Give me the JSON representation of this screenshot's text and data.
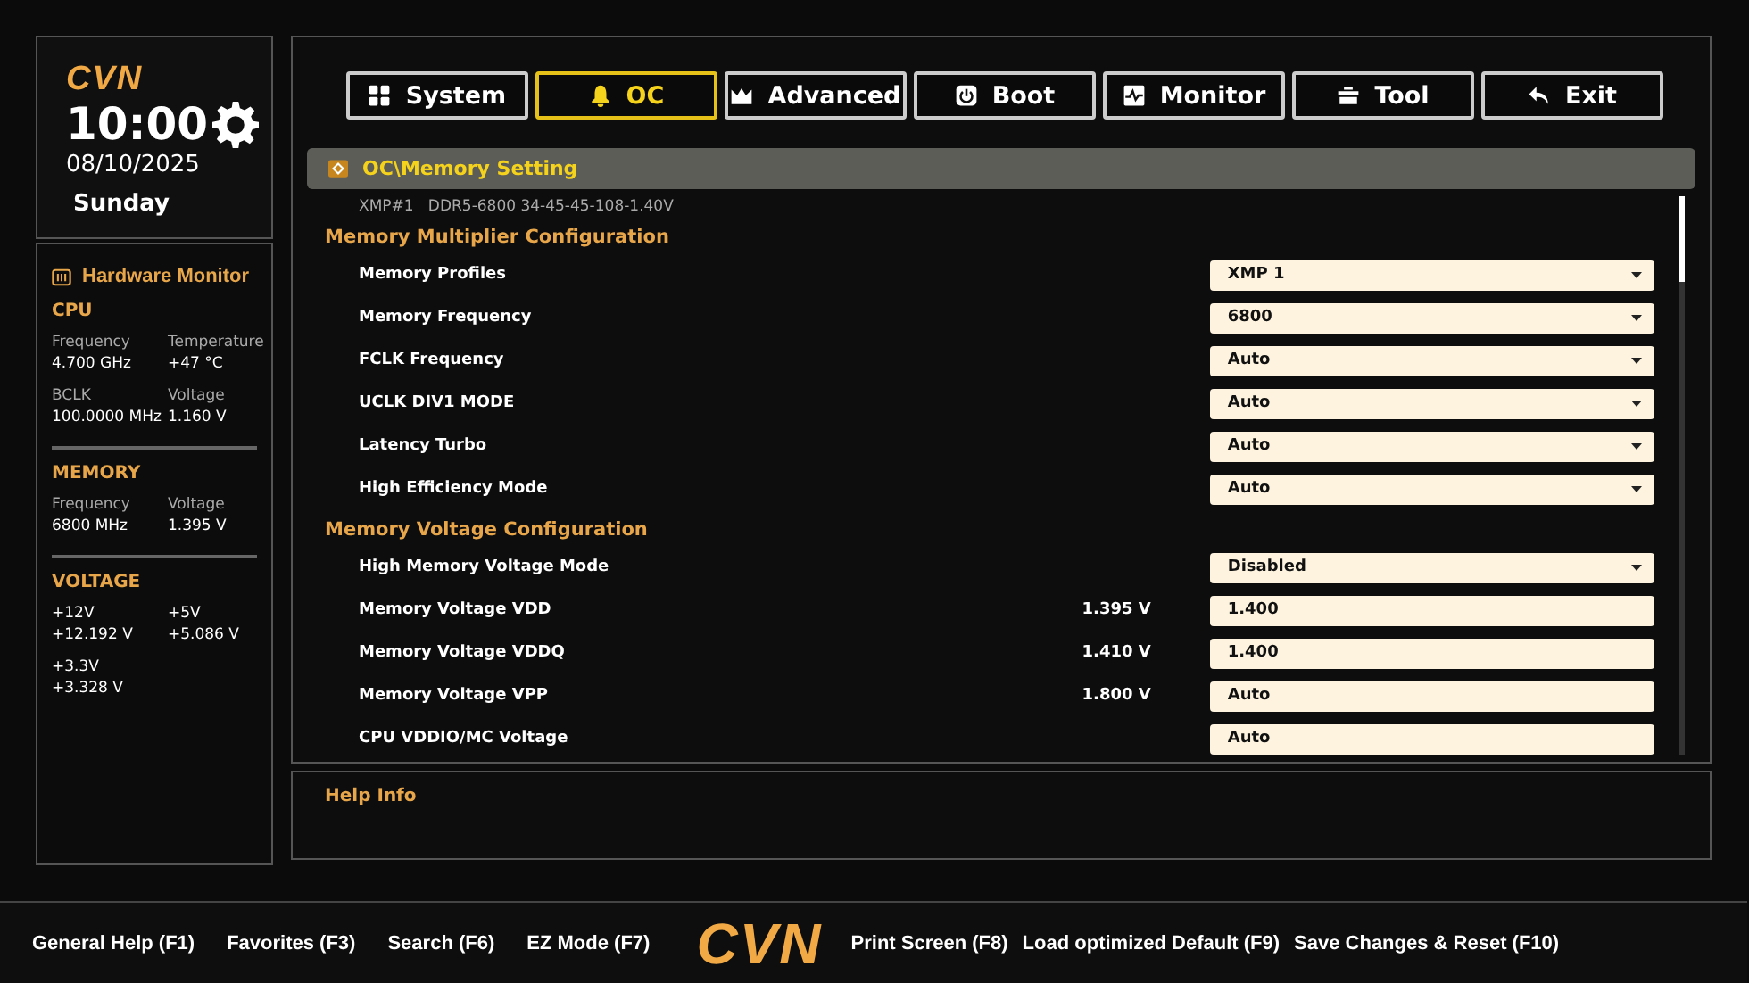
{
  "clock": {
    "logo": "CVN",
    "time": "10:00",
    "date": "08/10/2025",
    "weekday": "Sunday"
  },
  "hardware_monitor": {
    "title": "Hardware Monitor",
    "groups": [
      {
        "title": "CPU",
        "items": [
          {
            "label": "Frequency",
            "value": "4.700 GHz"
          },
          {
            "label": "Temperature",
            "value": "+47 °C"
          },
          {
            "label": "BCLK",
            "value": "100.0000 MHz"
          },
          {
            "label": "Voltage",
            "value": "1.160 V"
          }
        ]
      },
      {
        "title": "MEMORY",
        "items": [
          {
            "label": "Frequency",
            "value": "6800 MHz"
          },
          {
            "label": "Voltage",
            "value": "1.395 V"
          }
        ]
      },
      {
        "title": "VOLTAGE",
        "items": [
          {
            "label": "+12V",
            "value": "+12.192 V"
          },
          {
            "label": "+5V",
            "value": "+5.086 V"
          },
          {
            "label": "+3.3V",
            "value": "+3.328 V"
          }
        ]
      }
    ]
  },
  "tabs": [
    {
      "label": "System",
      "selected": false
    },
    {
      "label": "OC",
      "selected": true
    },
    {
      "label": "Advanced",
      "selected": false
    },
    {
      "label": "Boot",
      "selected": false
    },
    {
      "label": "Monitor",
      "selected": false
    },
    {
      "label": "Tool",
      "selected": false
    },
    {
      "label": "Exit",
      "selected": false
    }
  ],
  "breadcrumb": "OC\\Memory Setting",
  "info_line": "XMP#1   DDR5-6800 34-45-45-108-1.40V",
  "settings": [
    {
      "kind": "heading",
      "label": "Memory Multiplier Configuration"
    },
    {
      "kind": "dropdown",
      "label": "Memory Profiles",
      "value": "XMP 1"
    },
    {
      "kind": "dropdown",
      "label": "Memory Frequency",
      "value": "6800"
    },
    {
      "kind": "dropdown",
      "label": "FCLK Frequency",
      "value": "Auto"
    },
    {
      "kind": "dropdown",
      "label": "UCLK DIV1 MODE",
      "value": "Auto"
    },
    {
      "kind": "dropdown",
      "label": "Latency Turbo",
      "value": "Auto"
    },
    {
      "kind": "dropdown",
      "label": "High Efficiency Mode",
      "value": "Auto"
    },
    {
      "kind": "heading",
      "label": "Memory Voltage Configuration"
    },
    {
      "kind": "dropdown",
      "label": "High Memory Voltage Mode",
      "value": "Disabled"
    },
    {
      "kind": "input",
      "label": "Memory Voltage VDD",
      "reading": "1.395 V",
      "value": "1.400"
    },
    {
      "kind": "input",
      "label": "Memory Voltage VDDQ",
      "reading": "1.410 V",
      "value": "1.400"
    },
    {
      "kind": "input",
      "label": "Memory Voltage VPP",
      "reading": "1.800 V",
      "value": "Auto"
    },
    {
      "kind": "input",
      "label": "CPU VDDIO/MC Voltage",
      "value": "Auto"
    }
  ],
  "help": {
    "title": "Help Info"
  },
  "footer": {
    "left": [
      "General Help (F1)",
      "Favorites (F3)",
      "Search (F6)",
      "EZ Mode (F7)"
    ],
    "logo": "CVN",
    "right": [
      "Print Screen (F8)",
      "Load optimized Default (F9)",
      "Save Changes & Reset (F10)"
    ]
  }
}
